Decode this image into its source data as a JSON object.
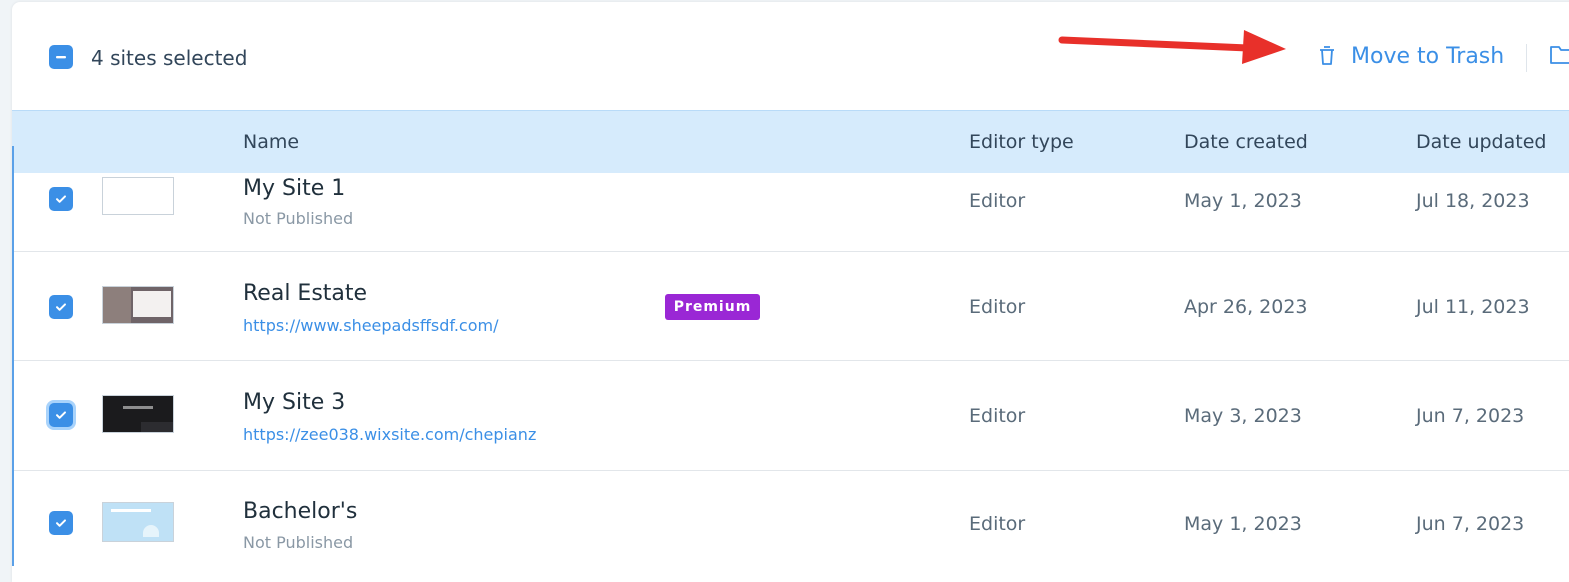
{
  "bulk_bar": {
    "selected_text": "4 sites selected",
    "trash_label": "Move to Trash"
  },
  "columns": {
    "name": "Name",
    "editor_type": "Editor type",
    "date_created": "Date created",
    "date_updated": "Date updated"
  },
  "rows": [
    {
      "name": "My Site 1",
      "subtitle": "Not Published",
      "subtitle_kind": "status",
      "badge": "",
      "editor": "Editor",
      "created": "May 1, 2023",
      "updated": "Jul 18, 2023",
      "checked": true
    },
    {
      "name": "Real Estate",
      "subtitle": "https://www.sheepadsffsdf.com/",
      "subtitle_kind": "url",
      "badge": "Premium",
      "editor": "Editor",
      "created": "Apr 26, 2023",
      "updated": "Jul 11, 2023",
      "checked": true
    },
    {
      "name": "My Site 3",
      "subtitle": "https://zee038.wixsite.com/chepianz",
      "subtitle_kind": "url",
      "badge": "",
      "editor": "Editor",
      "created": "May 3, 2023",
      "updated": "Jun 7, 2023",
      "checked": true
    },
    {
      "name": "Bachelor's",
      "subtitle": "Not Published",
      "subtitle_kind": "status",
      "badge": "",
      "editor": "Editor",
      "created": "May 1, 2023",
      "updated": "Jun 7, 2023",
      "checked": true
    }
  ],
  "colors": {
    "accent": "#3b8fe6",
    "header_bg": "#d6ebfc",
    "premium_badge": "#9a27d5",
    "annotation_arrow": "#e8302a"
  },
  "icons": [
    "minus-checkbox-icon",
    "check-icon",
    "trash-icon",
    "folder-icon",
    "annotation-arrow"
  ]
}
